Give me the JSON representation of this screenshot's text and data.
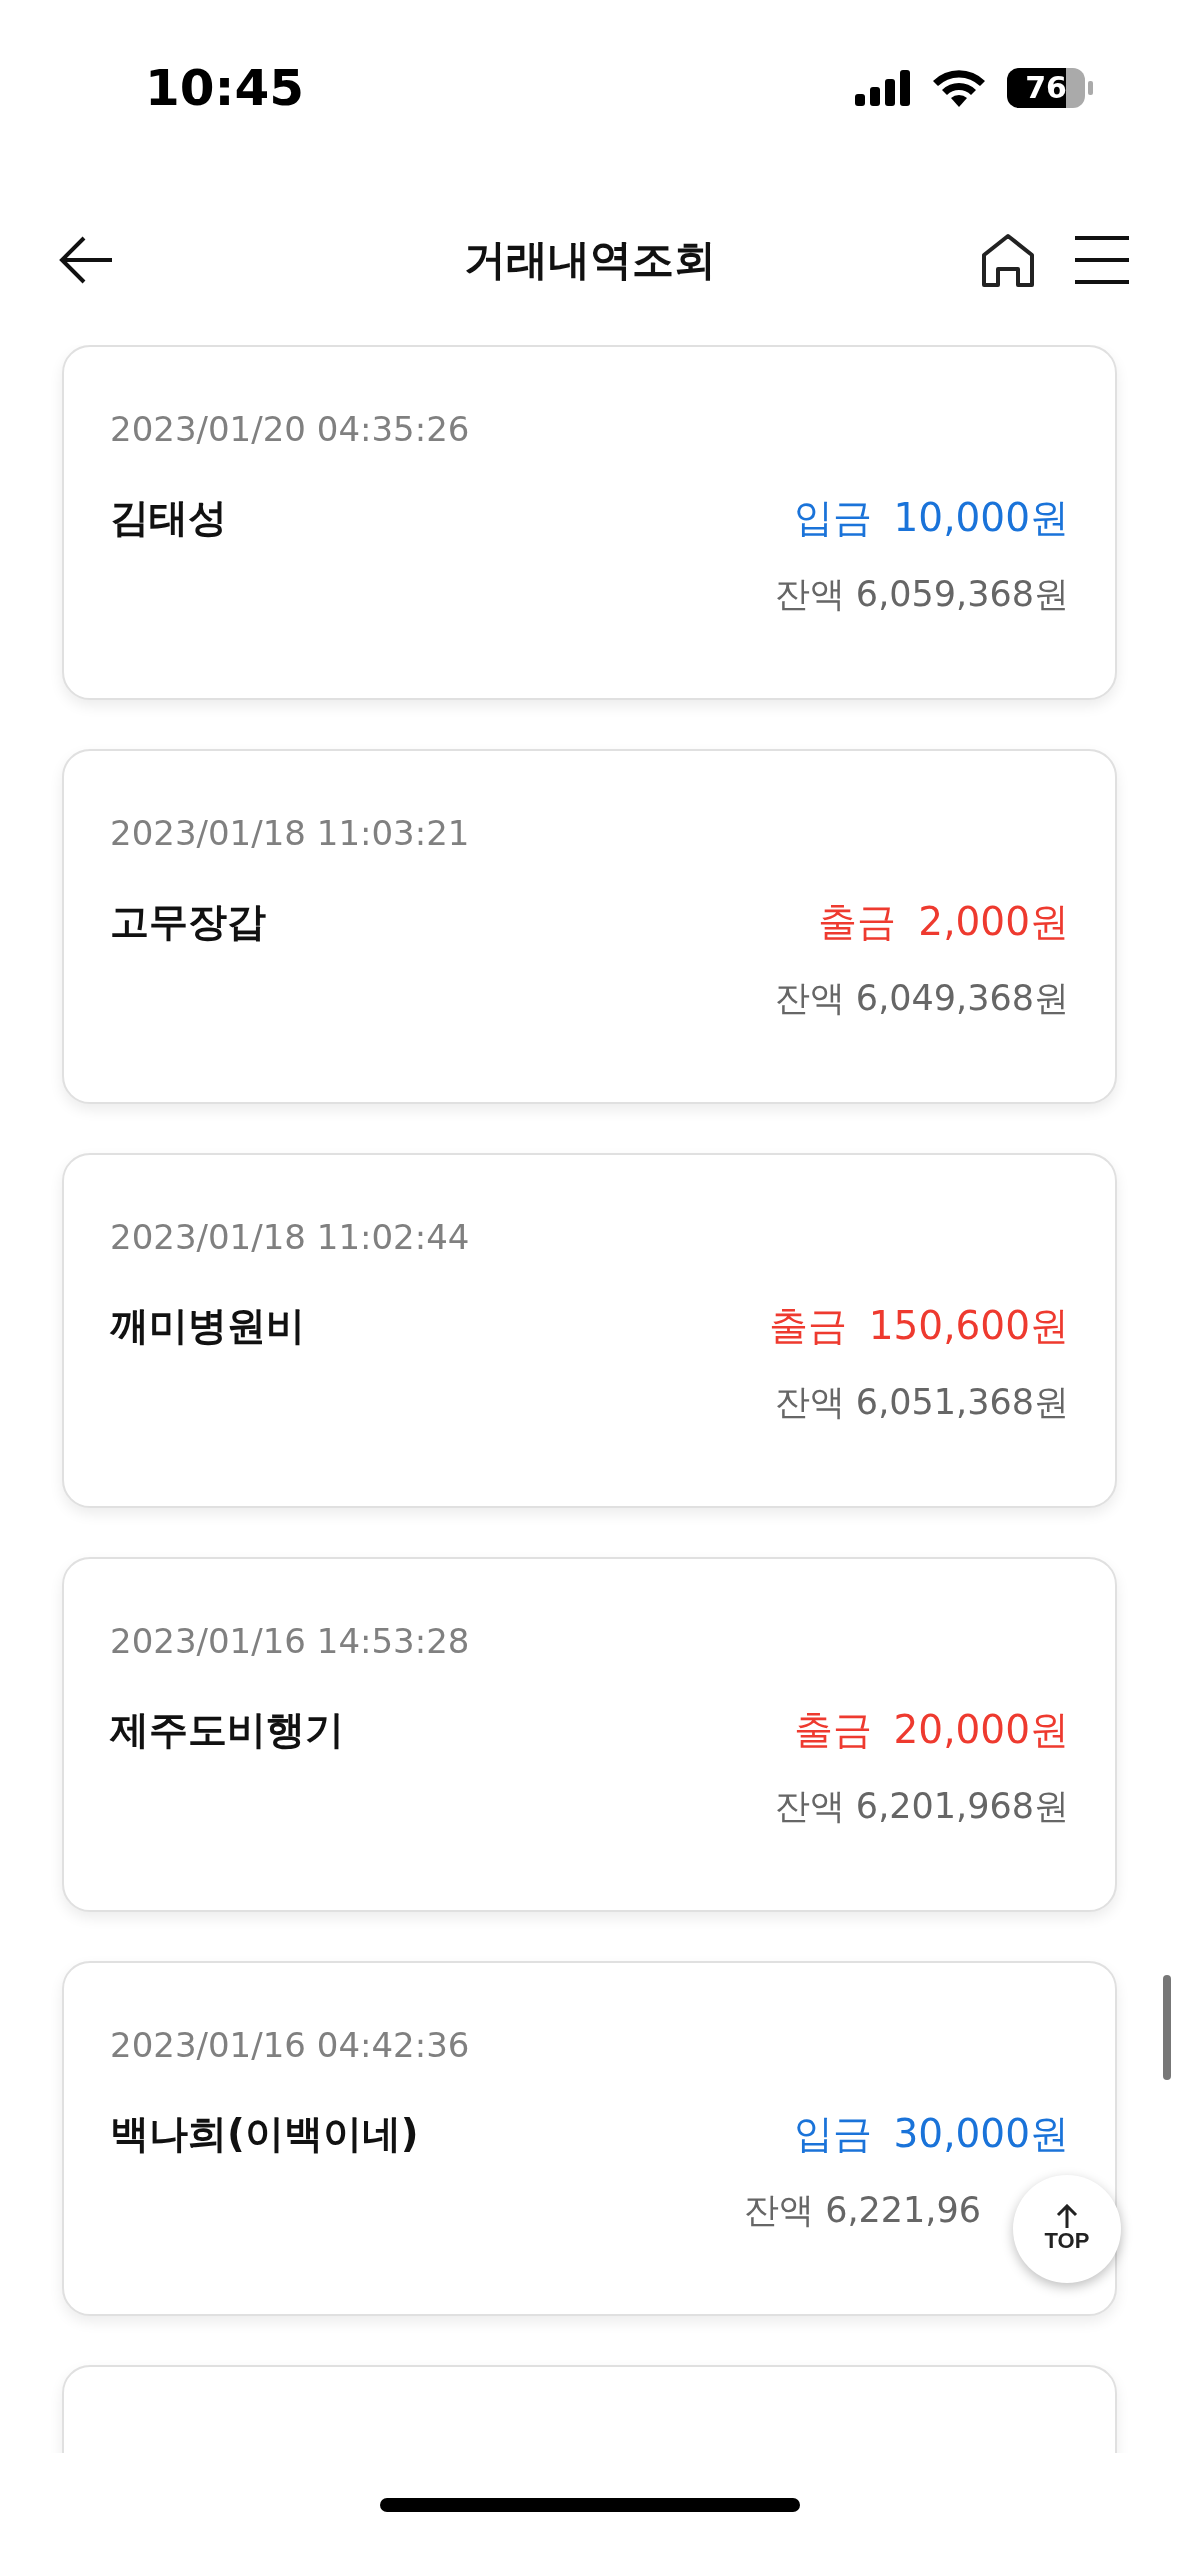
{
  "status_bar": {
    "time": "10:45",
    "battery": "76"
  },
  "header": {
    "title": "거래내역조회"
  },
  "transactions": [
    {
      "date": "2023/01/20 04:35:26",
      "name": "김태성",
      "kind": "deposit",
      "type_label": "입금",
      "amount": "10,000원",
      "balance": "잔액 6,059,368원"
    },
    {
      "date": "2023/01/18 11:03:21",
      "name": "고무장갑",
      "kind": "withdrawal",
      "type_label": "출금",
      "amount": "2,000원",
      "balance": "잔액 6,049,368원"
    },
    {
      "date": "2023/01/18 11:02:44",
      "name": "깨미병원비",
      "kind": "withdrawal",
      "type_label": "출금",
      "amount": "150,600원",
      "balance": "잔액 6,051,368원"
    },
    {
      "date": "2023/01/16 14:53:28",
      "name": "제주도비행기",
      "kind": "withdrawal",
      "type_label": "출금",
      "amount": "20,000원",
      "balance": "잔액 6,201,968원"
    },
    {
      "date": "2023/01/16 04:42:36",
      "name": "백나희(이백이네)",
      "kind": "deposit",
      "type_label": "입금",
      "amount": "30,000원",
      "balance": "잔액 6,221,96"
    }
  ],
  "top_button": {
    "label": "TOP"
  }
}
